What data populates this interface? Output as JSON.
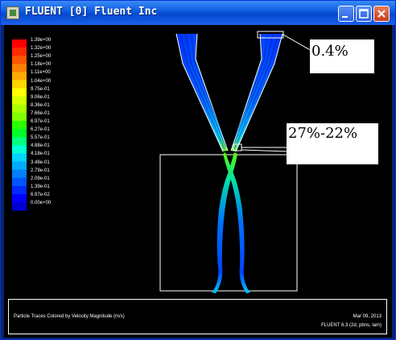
{
  "window": {
    "title": "FLUENT  [0] Fluent Inc",
    "buttons": [
      "minimize",
      "maximize",
      "close"
    ]
  },
  "colormap": {
    "labels": [
      "1.39e+00",
      "1.32e+00",
      "1.25e+00",
      "1.18e+00",
      "1.11e+00",
      "1.04e+00",
      "9.75e-01",
      "9.06e-01",
      "8.36e-01",
      "7.66e-01",
      "6.97e-01",
      "6.27e-01",
      "5.57e-01",
      "4.88e-01",
      "4.18e-01",
      "3.48e-01",
      "2.79e-01",
      "2.09e-01",
      "1.39e-01",
      "6.97e-02",
      "0.00e+00"
    ],
    "colors": [
      "#ff0000",
      "#ff2a00",
      "#ff5500",
      "#ff7f00",
      "#ffaa00",
      "#ffd400",
      "#ffff00",
      "#d4ff00",
      "#aaff00",
      "#7fff00",
      "#2aff00",
      "#00ff2a",
      "#00ff7f",
      "#00ffd4",
      "#00d4ff",
      "#00aaff",
      "#007fff",
      "#0055ff",
      "#002aff",
      "#0000ff",
      "#0000d4"
    ]
  },
  "caption": {
    "description": "Particle Traces Colored by Velocity Magnitude (m/s)",
    "date": "Mar 09, 2013",
    "version": "FLUENT 6.3 (2d, pbns, lam)"
  },
  "annotations": {
    "note_top": "0.4%",
    "note_mid": "27%-22%"
  }
}
